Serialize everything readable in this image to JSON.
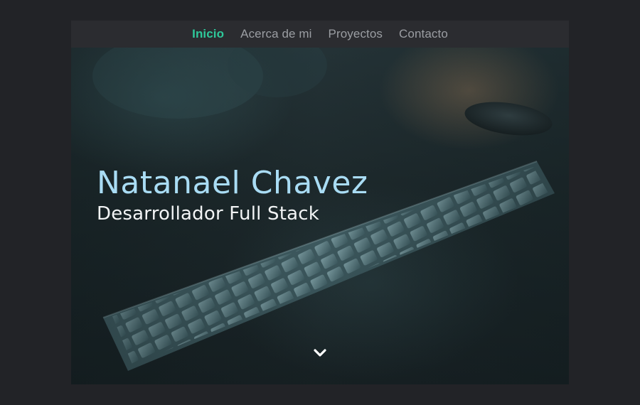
{
  "nav": {
    "items": [
      {
        "label": "Inicio",
        "active": true
      },
      {
        "label": "Acerca de mi",
        "active": false
      },
      {
        "label": "Proyectos",
        "active": false
      },
      {
        "label": "Contacto",
        "active": false
      }
    ]
  },
  "hero": {
    "name": "Natanael Chavez",
    "role": "Desarrollador Full Stack",
    "scroll_icon": "chevron-down-icon"
  },
  "colors": {
    "background": "#222327",
    "nav_bg": "#2b2c30",
    "nav_text": "#9b9ea3",
    "nav_active": "#2ec89a",
    "hero_name": "#a9dcf4",
    "hero_role": "#f2f4f5"
  }
}
